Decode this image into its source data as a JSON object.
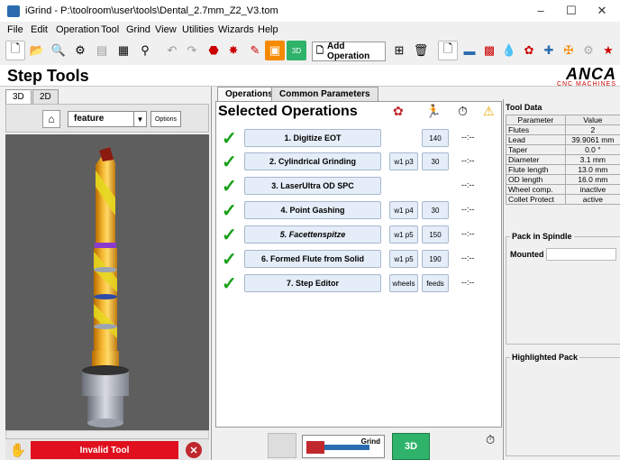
{
  "window": {
    "title": "iGrind - P:\\toolroom\\user\\tools\\Dental_2.7mm_Z2_V3.tom",
    "minimize": "–",
    "maximize": "☐",
    "close": "✕"
  },
  "menu": [
    {
      "label": "File"
    },
    {
      "label": "Edit"
    },
    {
      "label": "Operation"
    },
    {
      "label": "Tool"
    },
    {
      "label": "Grind"
    },
    {
      "label": "View"
    },
    {
      "label": "Utilities"
    },
    {
      "label": "Wizards"
    },
    {
      "label": "Help"
    }
  ],
  "toolbar": {
    "add_operation_label": "Add Operation"
  },
  "header": {
    "title": "Step Tools",
    "logo_text": "ANCA",
    "logo_sub": "CNC MACHINES"
  },
  "left_panel": {
    "tabs": [
      "3D",
      "2D"
    ],
    "feature_value": "feature",
    "options_label": "Options",
    "status_label": "Invalid Tool"
  },
  "center": {
    "tabs": [
      "Operations",
      "Common Parameters"
    ],
    "title": "Selected Operations",
    "operations": [
      {
        "name": "1. Digitize EOT",
        "p1": "",
        "p2": "140",
        "time": "--:--"
      },
      {
        "name": "2. Cylindrical Grinding",
        "p1": "w1 p3",
        "p2": "30",
        "time": "--:--"
      },
      {
        "name": "3. LaserUltra OD SPC",
        "p1": "",
        "p2": "",
        "time": "--:--"
      },
      {
        "name": "4. Point Gashing",
        "p1": "w1 p4",
        "p2": "30",
        "time": "--:--"
      },
      {
        "name": "5. Facettenspitze",
        "p1": "w1 p5",
        "p2": "150",
        "time": "--:--"
      },
      {
        "name": "6. Formed Flute from Solid",
        "p1": "w1 p5",
        "p2": "190",
        "time": "--:--"
      },
      {
        "name": "7. Step Editor",
        "p1": "wheels",
        "p2": "feeds",
        "time": "--:--"
      }
    ],
    "grind_label": "Grind",
    "btn3d_label": "3D"
  },
  "tool_data": {
    "title": "Tool Data",
    "header": [
      "Parameter",
      "Value"
    ],
    "rows": [
      [
        "Flutes",
        "2"
      ],
      [
        "Lead",
        "39.9061 mm"
      ],
      [
        "Taper",
        "0.0 °"
      ],
      [
        "Diameter",
        "3.1 mm"
      ],
      [
        "Flute length",
        "13.0 mm"
      ],
      [
        "OD length",
        "16.0 mm"
      ],
      [
        "Wheel comp.",
        "inactive"
      ],
      [
        "Collet Protect",
        "active"
      ]
    ],
    "pack_in_spindle": "Pack in Spindle",
    "mounted_label": "Mounted",
    "highlighted_pack": "Highlighted Pack"
  },
  "colors": {
    "accent_green": "#17a017",
    "invalid_red": "#e0101e",
    "grind_3d_green": "#2fb36a"
  }
}
